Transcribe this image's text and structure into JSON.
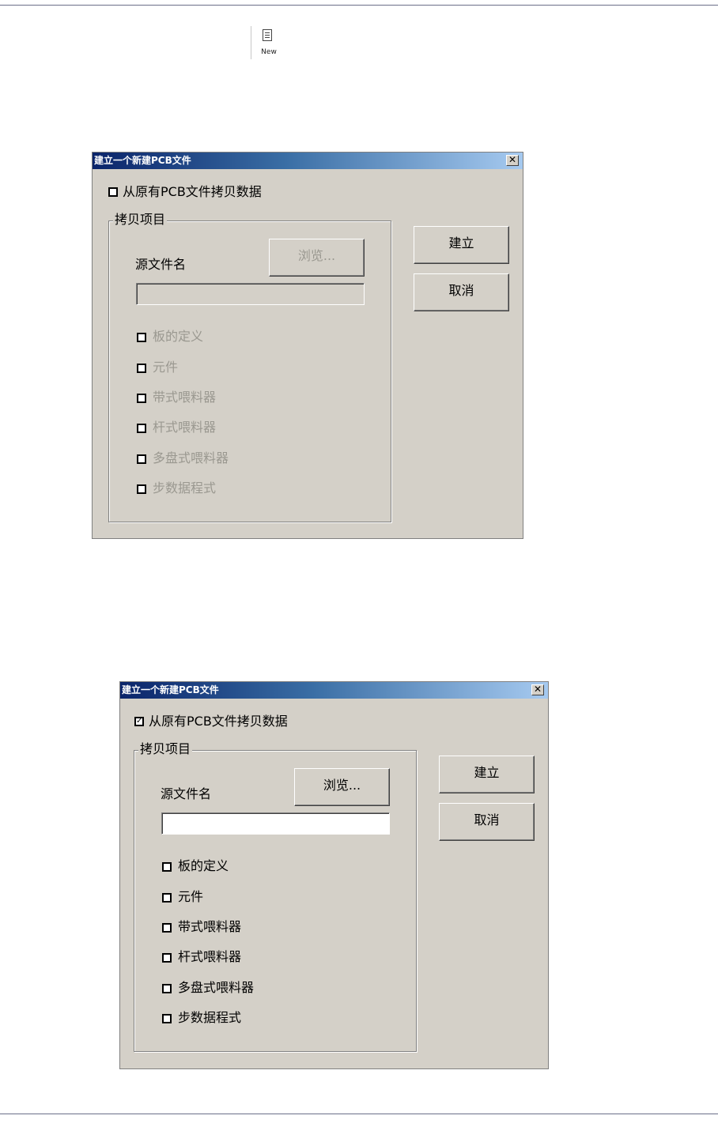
{
  "toolbar": {
    "new_label": "New",
    "new_icon": "document-icon"
  },
  "dialogs": [
    {
      "state": "disabled",
      "title": "建立一个新建PCB文件",
      "close_glyph": "✕",
      "copy_checkbox": {
        "label": "从原有PCB文件拷贝数据",
        "checked": false
      },
      "group_title": "拷贝项目",
      "source_label": "源文件名",
      "source_value": "",
      "browse_label": "浏览...",
      "create_label": "建立",
      "cancel_label": "取消",
      "items": [
        {
          "label": "板的定义",
          "checked": false
        },
        {
          "label": "元件",
          "checked": false
        },
        {
          "label": "带式喂料器",
          "checked": false
        },
        {
          "label": "杆式喂料器",
          "checked": false
        },
        {
          "label": "多盘式喂料器",
          "checked": false
        },
        {
          "label": "步数据程式",
          "checked": false
        }
      ]
    },
    {
      "state": "enabled",
      "title": "建立一个新建PCB文件",
      "close_glyph": "✕",
      "copy_checkbox": {
        "label": "从原有PCB文件拷贝数据",
        "checked": true
      },
      "group_title": "拷贝项目",
      "source_label": "源文件名",
      "source_value": "",
      "browse_label": "浏览...",
      "create_label": "建立",
      "cancel_label": "取消",
      "items": [
        {
          "label": "板的定义",
          "checked": false
        },
        {
          "label": "元件",
          "checked": false
        },
        {
          "label": "带式喂料器",
          "checked": false
        },
        {
          "label": "杆式喂料器",
          "checked": false
        },
        {
          "label": "多盘式喂料器",
          "checked": false
        },
        {
          "label": "步数据程式",
          "checked": false
        }
      ]
    }
  ],
  "colors": {
    "dialog_bg": "#d4d0c8",
    "title_start": "#0a246a",
    "title_end": "#a6caf0",
    "disabled_text": "#9a9890"
  }
}
